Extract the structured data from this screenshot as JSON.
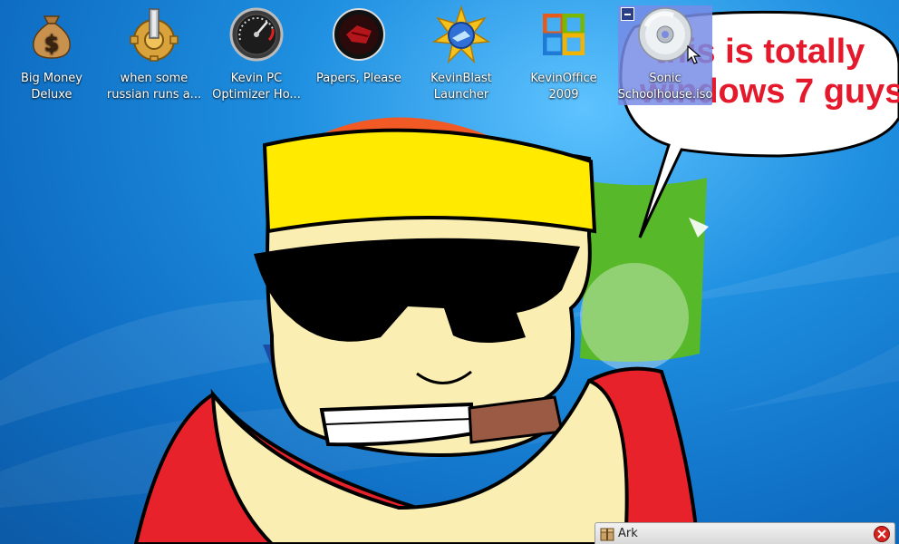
{
  "desktop": {
    "icons": [
      {
        "label": "Big Money\nDeluxe",
        "icon": "money-bag-icon"
      },
      {
        "label": "when some\nrussian runs a...",
        "icon": "gear-icon"
      },
      {
        "label": "Kevin PC\nOptimizer Ho...",
        "icon": "speedometer-icon"
      },
      {
        "label": "Papers, Please",
        "icon": "papers-please-icon"
      },
      {
        "label": "KevinBlast\nLauncher",
        "icon": "kevinblast-icon"
      },
      {
        "label": "KevinOffice\n2009",
        "icon": "office-logo-icon"
      },
      {
        "label": "Sonic\nSchoolhouse.iso",
        "icon": "disc-icon",
        "selected": true
      }
    ]
  },
  "wallpaper": {
    "speech_line_1": "this is totally",
    "speech_line_2": "windows 7 guys"
  },
  "taskbar": {
    "window_title": "Ark",
    "close_icon": "close-icon"
  },
  "colors": {
    "selection": "#7b8ce0",
    "speech_text": "#e4192b",
    "close_button": "#d9231e"
  }
}
